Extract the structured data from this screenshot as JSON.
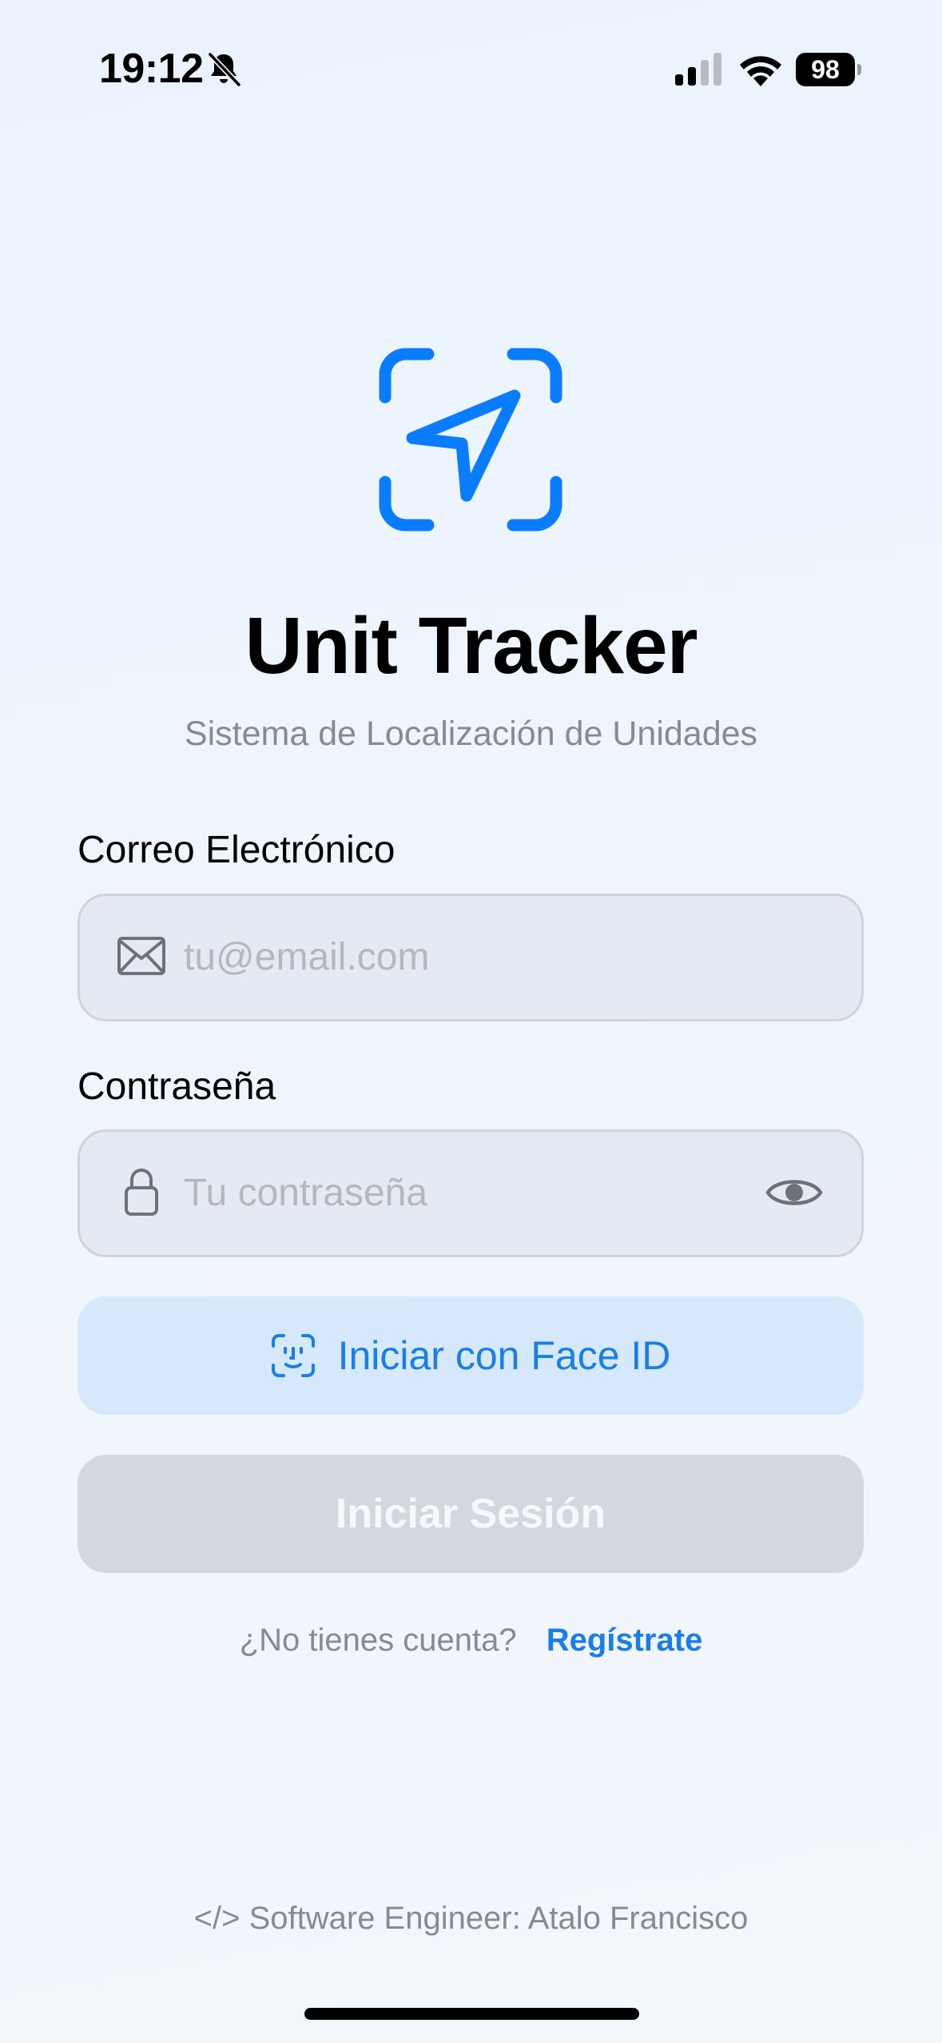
{
  "status_bar": {
    "time": "19:12",
    "battery": "98",
    "icons": [
      "bell-slash-icon",
      "cellular-signal-icon",
      "wifi-icon",
      "battery-icon"
    ]
  },
  "colors": {
    "accent": "#1a7ee6",
    "logo_blue": "#0a7cff",
    "muted_text": "#868a92",
    "disabled_button": "#d3d8df",
    "faceid_button_bg": "#d6e8fb"
  },
  "app": {
    "logo_icon": "location-arrow-viewfinder-icon",
    "title": "Unit Tracker",
    "subtitle": "Sistema de Localización de Unidades"
  },
  "form": {
    "email": {
      "label": "Correo Electrónico",
      "placeholder": "tu@email.com",
      "value": "",
      "icon": "envelope-icon"
    },
    "password": {
      "label": "Contraseña",
      "placeholder": "Tu contraseña",
      "value": "",
      "icon": "lock-icon",
      "toggle_icon": "eye-icon"
    },
    "faceid_button": {
      "label": "Iniciar con Face ID",
      "icon": "faceid-icon"
    },
    "login_button": {
      "label": "Iniciar Sesión"
    }
  },
  "signup": {
    "question": "¿No tienes cuenta?",
    "link": "Regístrate"
  },
  "footer": {
    "credit": "</> Software Engineer: Atalo Francisco"
  }
}
